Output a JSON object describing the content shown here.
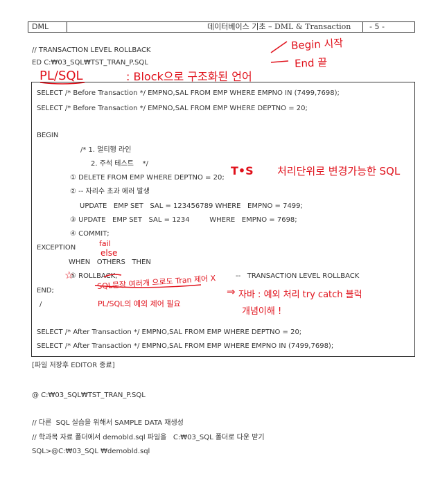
{
  "header": {
    "left": "DML",
    "center": "데이터베이스 기초 – DML & Transaction",
    "page": "- 5 -"
  },
  "intro": {
    "comment": "// TRANSACTION LEVEL ROLLBACK",
    "edit_cmd": "ED C:₩03_SQL₩TST_TRAN_P.SQL"
  },
  "code": {
    "l1": "SELECT /* Before Transaction */ EMPNO,SAL FROM EMP WHERE EMPNO IN (7499,7698);",
    "l2": "SELECT /* Before Transaction */ EMPNO,SAL FROM EMP WHERE DEPTNO = 20;",
    "begin": "BEGIN",
    "c1": "/* 1. 멀티행 라인",
    "c2": "2. 주석 테스트    */",
    "s1": "① DELETE FROM EMP WHERE DEPTNO = 20;",
    "s2": "② -- 자리수 초과 에러 발생",
    "s2b": "UPDATE   EMP SET   SAL = 123456789 WHERE   EMPNO = 7499;",
    "s3": "③ UPDATE   EMP SET   SAL = 1234         WHERE   EMPNO = 7698;",
    "s4": "④ COMMIT;",
    "exception": "EXCEPTION",
    "when": "WHEN   OTHERS   THEN",
    "s5": "⑤ ROLLBACK;",
    "s5_comment": "--   TRANSACTION LEVEL ROLLBACK",
    "end": "END;",
    "slash": "/",
    "l3": "SELECT /* After Transaction */ EMPNO,SAL FROM EMP WHERE DEPTNO = 20;",
    "l4": "SELECT /* After Transaction */ EMPNO,SAL FROM EMP WHERE EMPNO IN (7499,7698);"
  },
  "footer": {
    "save_note": "[파일 저장후 EDITOR 종료]",
    "run_cmd": "@ C:₩03_SQL₩TST_TRAN_P.SQL",
    "note1": "// 다른  SQL 실습을 위해서 SAMPLE DATA 재생성",
    "note2": "// 학과목 자료 폴더에서 demobld.sql 파일을   C:₩03_SQL 폴더로 다운 받기",
    "cmd2": "SQL>@C:₩03_SQL ₩demobld.sql"
  },
  "handwriting": {
    "begin_start": "Begin 시작",
    "end_end": "End 끝",
    "plsql": "PL/SQL",
    "block_struct": ": Block으로 구조화된 언어",
    "tos": "T•S",
    "tos_note": "처리단위로 변경가능한 SQL",
    "fail": "fail",
    "else": "else",
    "star": "☆",
    "rollback_note1": "SQL문장 여러개 으로도 Tran 제어 X",
    "rollback_note2": "PL/SQL의 예외 제어 필요",
    "arrow": "⇒",
    "exception_note": "자바 : 예외 처리 try catch 블럭",
    "concept": "개념이해 !"
  }
}
